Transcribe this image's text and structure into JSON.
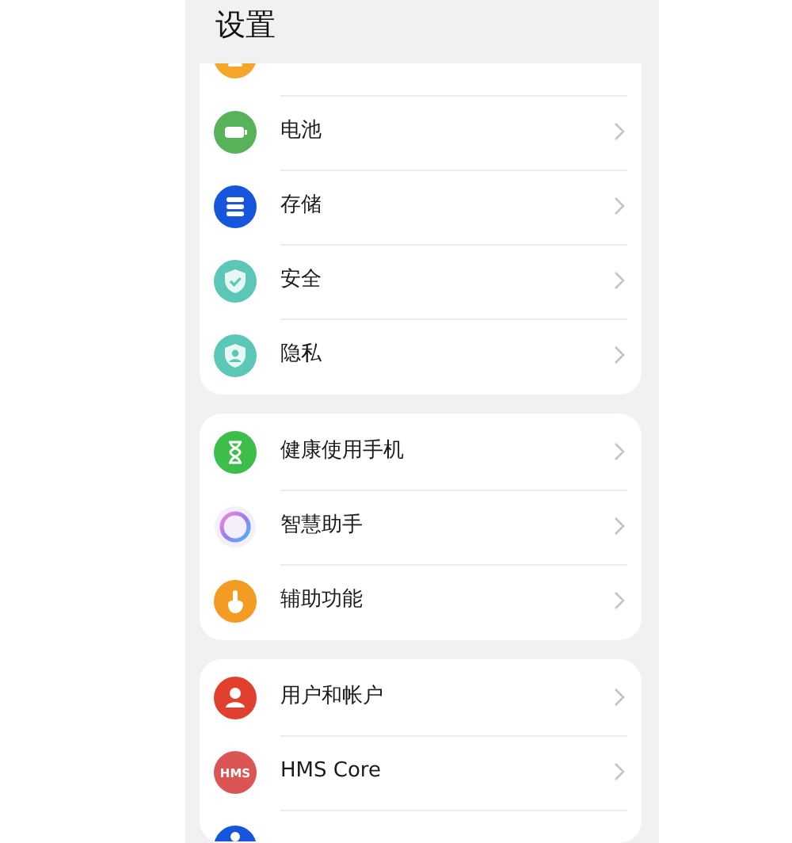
{
  "header": {
    "title": "设置"
  },
  "groups": [
    {
      "items": [
        {
          "kind": "cut"
        },
        {
          "kind": "entry",
          "label": "电池"
        },
        {
          "kind": "entry",
          "label": "存储"
        },
        {
          "kind": "entry",
          "label": "安全"
        },
        {
          "kind": "entry",
          "label": "隐私"
        }
      ]
    },
    {
      "items": [
        {
          "kind": "entry",
          "label": "健康使用手机"
        },
        {
          "kind": "entry",
          "label": "智慧助手"
        },
        {
          "kind": "entry",
          "label": "辅助功能"
        }
      ]
    },
    {
      "items": [
        {
          "kind": "entry",
          "label": "用户和帐户"
        },
        {
          "kind": "entry",
          "logo_text": "HMS",
          "label": "HMS Core"
        },
        {
          "kind": "cut"
        }
      ]
    }
  ]
}
